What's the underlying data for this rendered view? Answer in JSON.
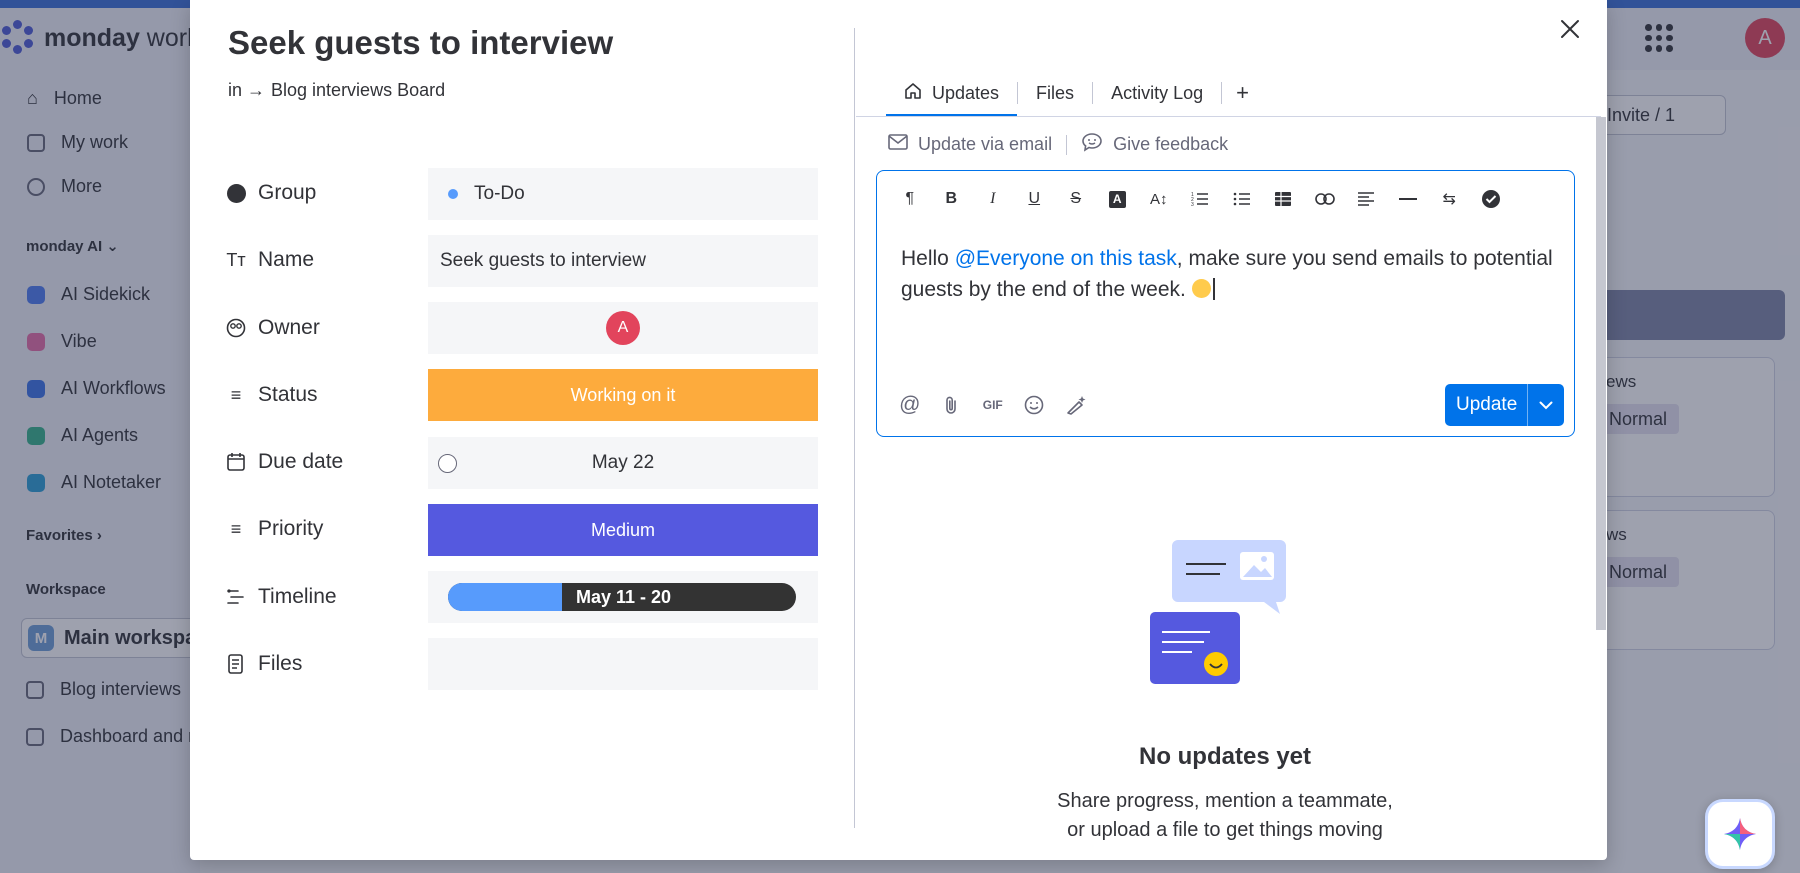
{
  "app": {
    "brand_bold": "monday",
    "brand_rest": " work",
    "user_initial": "A",
    "invite_label": "Invite / 1"
  },
  "sidebar": {
    "items": [
      {
        "label": "Home"
      },
      {
        "label": "My work"
      },
      {
        "label": "More"
      }
    ],
    "ai_section": "monday AI",
    "ai_items": [
      {
        "label": "AI Sidekick",
        "color": "#4d7cf0"
      },
      {
        "label": "Vibe",
        "color": "#e86ea8"
      },
      {
        "label": "AI Workflows",
        "color": "#3b74e8"
      },
      {
        "label": "AI Agents",
        "color": "#35b38a"
      },
      {
        "label": "AI Notetaker",
        "color": "#2a9fd6"
      }
    ],
    "favorites": "Favorites",
    "workspace_section": "Workspace",
    "workspace_name": "Main workspa",
    "workspace_initial": "M",
    "boards": [
      {
        "label": "Blog interviews"
      },
      {
        "label": "Dashboard and r"
      }
    ]
  },
  "background": {
    "card1_title": "ews",
    "card2_title": "ws",
    "pill_label": "Normal"
  },
  "item": {
    "title": "Seek guests to interview",
    "breadcrumb_prefix": "in →",
    "breadcrumb_board": "Blog interviews Board"
  },
  "fields": {
    "group": {
      "label": "Group",
      "value": "To-Do",
      "dot_color": "#579bfc"
    },
    "name": {
      "label": "Name",
      "value": "Seek guests to interview"
    },
    "owner": {
      "label": "Owner",
      "initial": "A"
    },
    "status": {
      "label": "Status",
      "value": "Working on it",
      "color": "#fdab3d"
    },
    "due_date": {
      "label": "Due date",
      "value": "May 22"
    },
    "priority": {
      "label": "Priority",
      "value": "Medium",
      "color": "#5559df"
    },
    "timeline": {
      "label": "Timeline",
      "value": "May 11 - 20"
    },
    "files": {
      "label": "Files"
    }
  },
  "panel": {
    "tabs": [
      {
        "label": "Updates",
        "active": true
      },
      {
        "label": "Files"
      },
      {
        "label": "Activity Log"
      }
    ],
    "add_tab": "+",
    "update_via_email": "Update via email",
    "give_feedback": "Give feedback",
    "editor": {
      "text_before": "Hello ",
      "mention": "@Everyone on this task",
      "text_after": ", make sure you send emails to potential guests by the end of the week. ",
      "gif_label": "GIF",
      "submit_label": "Update"
    },
    "empty_title": "No updates yet",
    "empty_desc_line1": "Share progress, mention a teammate,",
    "empty_desc_line2": "or upload a file to get things moving"
  }
}
